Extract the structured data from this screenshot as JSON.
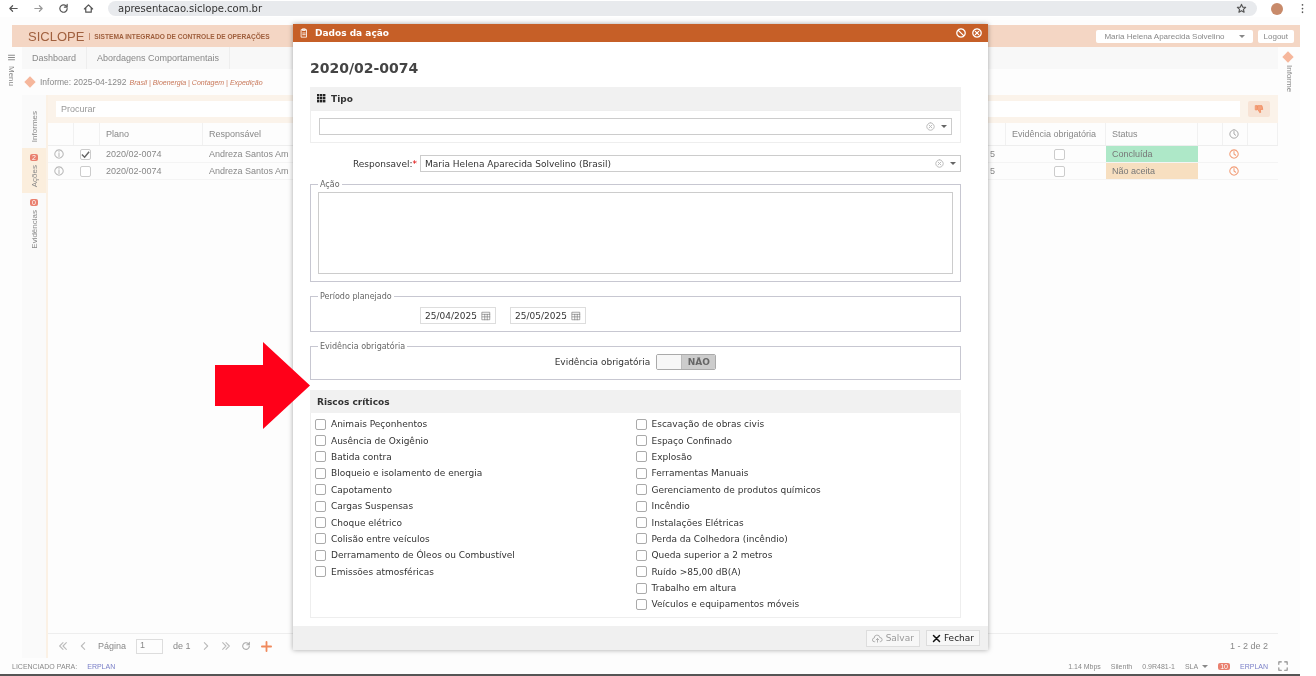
{
  "browser": {
    "url": "apresentacao.siclope.com.br"
  },
  "app": {
    "brand": "SICLOPE",
    "subtitle": "SISTEMA INTEGRADO DE CONTROLE DE OPERAÇÕES",
    "user": "Maria Helena Aparecida Solvelino",
    "logout": "Logout",
    "menu_label": "Menu",
    "right_rail": "Informe",
    "nav_tabs": [
      {
        "label": "Dashboard"
      },
      {
        "label": "Abordagens Comportamentais"
      }
    ],
    "informe": {
      "title": "Informe: 2025-04-1292",
      "path": "Brasil | Bioenergia | Contagem | Expedição"
    },
    "side_tabs": [
      {
        "label": "Informes",
        "selected": false
      },
      {
        "label": "Ações",
        "badge": "2",
        "selected": true
      },
      {
        "label": "Evidências",
        "badge": "0",
        "selected": false
      }
    ],
    "search": {
      "placeholder": "Procurar"
    },
    "table": {
      "columns": [
        "Plano",
        "Responsável",
        "Evidência obrigatória",
        "Status"
      ],
      "rows": [
        {
          "checked": true,
          "plano": "2020/02-0074",
          "responsavel": "Andreza Santos Am",
          "column_5": "5",
          "evidencia": false,
          "status": "Concluída",
          "color": "#aee8c8"
        },
        {
          "checked": false,
          "plano": "2020/02-0074",
          "responsavel": "Andreza Santos Am",
          "column_5": "5",
          "evidencia": false,
          "status": "Não aceita",
          "color": "#f7dfc0"
        }
      ]
    },
    "pagination": {
      "page_label": "Página",
      "page": "1",
      "of": "de 1",
      "count": "1 - 2 de 2"
    },
    "status_bar": {
      "licensed": "LICENCIADO PARA:",
      "licensee": "ERPLAN",
      "speed": "1.14 Mbps",
      "signal": "Silenth",
      "version": "0.9R481-1",
      "sla": "SLA",
      "badge": "10",
      "logo": "ERPLAN"
    }
  },
  "dialog": {
    "title": "Dados da ação",
    "code": "2020/02-0074",
    "tipo": {
      "title": "Tipo"
    },
    "responsavel": {
      "label": "Responsavel:",
      "required_mark": "*",
      "value": "Maria Helena Aparecida Solvelino (Brasil)"
    },
    "acao": {
      "legend": "Ação"
    },
    "periodo": {
      "legend": "Período planejado",
      "start": "25/04/2025",
      "end": "25/05/2025"
    },
    "evidencia": {
      "legend": "Evidência obrigatória",
      "label": "Evidência obrigatória",
      "toggle_text": "NÃO",
      "on": false
    },
    "riscos": {
      "title": "Riscos críticos",
      "left": [
        {
          "label": "Animais Peçonhentos",
          "checked": false
        },
        {
          "label": "Ausência de Oxigênio",
          "checked": false
        },
        {
          "label": "Batida contra",
          "checked": false
        },
        {
          "label": "Bloqueio e isolamento de energia",
          "checked": false
        },
        {
          "label": "Capotamento",
          "checked": false
        },
        {
          "label": "Cargas Suspensas",
          "checked": false
        },
        {
          "label": "Choque elétrico",
          "checked": false
        },
        {
          "label": "Colisão entre veículos",
          "checked": false
        },
        {
          "label": "Derramamento de Óleos ou Combustível",
          "checked": false
        },
        {
          "label": "Emissões atmosféricas",
          "checked": false
        }
      ],
      "right": [
        {
          "label": "Escavação de obras civis",
          "checked": false
        },
        {
          "label": "Espaço Confinado",
          "checked": false
        },
        {
          "label": "Explosão",
          "checked": false
        },
        {
          "label": "Ferramentas Manuais",
          "checked": false
        },
        {
          "label": "Gerenciamento de produtos químicos",
          "checked": false
        },
        {
          "label": "Incêndio",
          "checked": false
        },
        {
          "label": "Instalações Elétricas",
          "checked": false
        },
        {
          "label": "Perda da Colhedora (incêndio)",
          "checked": false
        },
        {
          "label": "Queda superior a 2 metros",
          "checked": false
        },
        {
          "label": "Ruído >85,00 dB(A)",
          "checked": false
        },
        {
          "label": "Trabalho em altura",
          "checked": false
        },
        {
          "label": "Veículos e equipamentos móveis",
          "checked": false
        }
      ]
    },
    "buttons": [
      {
        "kind": "save",
        "label": "Salvar",
        "disabled": true
      },
      {
        "kind": "close",
        "label": "Fechar",
        "disabled": false
      }
    ]
  }
}
